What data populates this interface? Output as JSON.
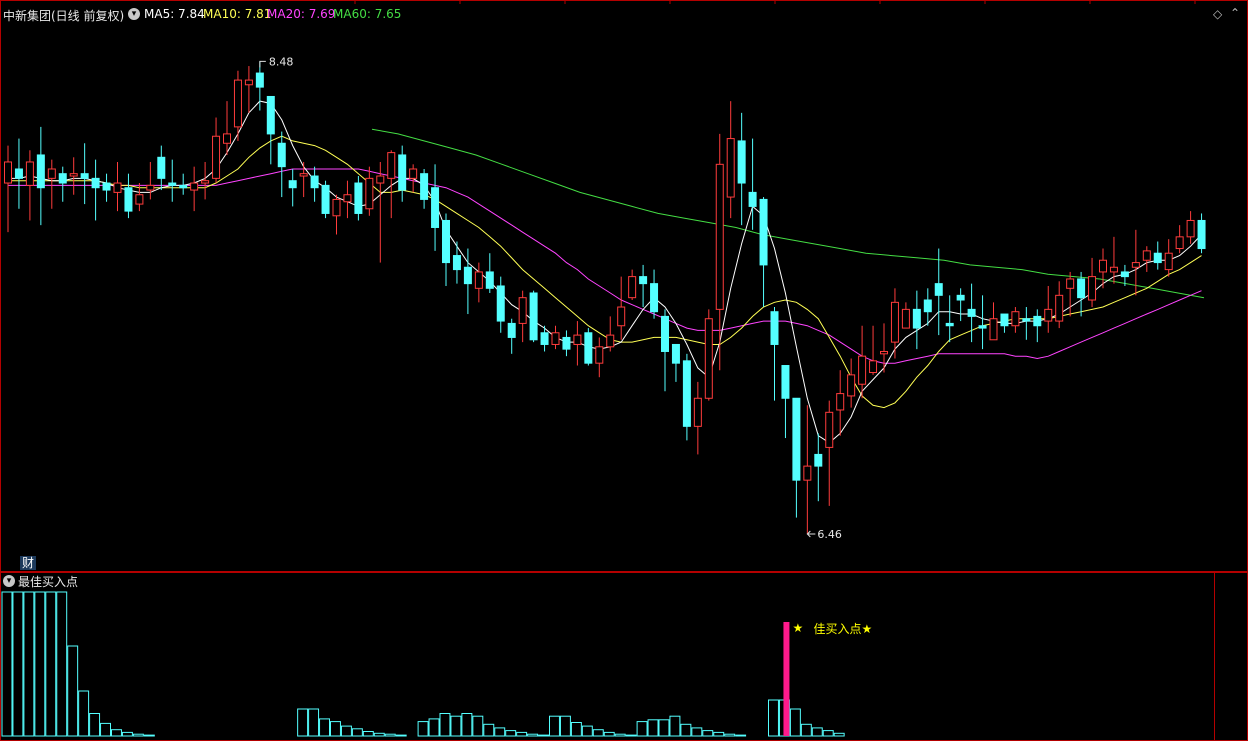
{
  "header": {
    "stock_name": "中新集团(日线 前复权)",
    "ma_labels": [
      {
        "text": "MA5: 7.84",
        "color": "#ffffff"
      },
      {
        "text": "MA10: 7.81",
        "color": "#ffff55"
      },
      {
        "text": "MA20: 7.69",
        "color": "#ff44ff"
      },
      {
        "text": "MA60: 7.65",
        "color": "#44dd44"
      }
    ]
  },
  "price_panel": {
    "high_label": "8.48",
    "low_label": "6.46",
    "fin_badge": "财"
  },
  "indicator_panel": {
    "title": "最佳买入点",
    "signal_text": "佳买入点★",
    "signal_star": "★"
  },
  "colors": {
    "up": "#ff3c3c",
    "down": "#54ffff",
    "frame": "#b40000",
    "ma5": "#ffffff",
    "ma10": "#ffff55",
    "ma20": "#ff44ff",
    "ma60": "#44dd44",
    "signal_bar": "#ff1a8c",
    "signal_text": "#ffff00"
  },
  "chart_data": {
    "type": "candlestick",
    "ylim": [
      6.4,
      8.55
    ],
    "candles": [
      [
        7.96,
        8.05,
        7.75,
        8.12
      ],
      [
        8.02,
        7.98,
        7.85,
        8.15
      ],
      [
        7.95,
        8.05,
        7.8,
        8.1
      ],
      [
        8.08,
        7.94,
        7.78,
        8.2
      ],
      [
        7.98,
        8.02,
        7.85,
        8.06
      ],
      [
        8.0,
        7.96,
        7.88,
        8.03
      ],
      [
        7.99,
        8.0,
        7.91,
        8.07
      ],
      [
        8.0,
        7.98,
        7.87,
        8.13
      ],
      [
        7.98,
        7.94,
        7.8,
        8.06
      ],
      [
        7.96,
        7.93,
        7.88,
        8.0
      ],
      [
        7.92,
        7.96,
        7.84,
        8.05
      ],
      [
        7.94,
        7.84,
        7.81,
        8.0
      ],
      [
        7.87,
        7.91,
        7.84,
        7.96
      ],
      [
        7.93,
        7.95,
        7.89,
        8.05
      ],
      [
        8.07,
        7.98,
        7.93,
        8.12
      ],
      [
        7.96,
        7.95,
        7.88,
        8.06
      ],
      [
        7.95,
        7.94,
        7.91,
        8.0
      ],
      [
        7.93,
        7.96,
        7.84,
        8.03
      ],
      [
        7.96,
        7.97,
        7.89,
        8.05
      ],
      [
        7.98,
        8.16,
        7.96,
        8.24
      ],
      [
        8.13,
        8.17,
        8.08,
        8.31
      ],
      [
        8.2,
        8.4,
        8.14,
        8.44
      ],
      [
        8.38,
        8.4,
        8.26,
        8.46
      ],
      [
        8.43,
        8.37,
        8.27,
        8.48
      ],
      [
        8.33,
        8.17,
        8.04,
        8.33
      ],
      [
        8.13,
        8.03,
        7.9,
        8.18
      ],
      [
        7.97,
        7.94,
        7.86,
        8.02
      ],
      [
        7.99,
        8.0,
        7.9,
        8.05
      ],
      [
        7.99,
        7.94,
        7.88,
        8.03
      ],
      [
        7.95,
        7.83,
        7.81,
        7.97
      ],
      [
        7.82,
        7.89,
        7.74,
        7.91
      ],
      [
        7.88,
        7.91,
        7.81,
        7.97
      ],
      [
        7.96,
        7.83,
        7.8,
        7.99
      ],
      [
        7.85,
        7.98,
        7.82,
        8.03
      ],
      [
        7.96,
        7.99,
        7.62,
        8.05
      ],
      [
        7.98,
        8.09,
        7.81,
        8.1
      ],
      [
        8.08,
        7.93,
        7.88,
        8.12
      ],
      [
        7.98,
        8.02,
        7.92,
        8.04
      ],
      [
        8.0,
        7.89,
        7.85,
        8.02
      ],
      [
        7.94,
        7.77,
        7.67,
        8.04
      ],
      [
        7.8,
        7.62,
        7.52,
        7.83
      ],
      [
        7.65,
        7.59,
        7.53,
        7.71
      ],
      [
        7.6,
        7.53,
        7.4,
        7.68
      ],
      [
        7.51,
        7.58,
        7.45,
        7.62
      ],
      [
        7.58,
        7.51,
        7.49,
        7.66
      ],
      [
        7.52,
        7.37,
        7.32,
        7.56
      ],
      [
        7.36,
        7.3,
        7.23,
        7.38
      ],
      [
        7.36,
        7.47,
        7.28,
        7.5
      ],
      [
        7.49,
        7.29,
        7.28,
        7.5
      ],
      [
        7.32,
        7.27,
        7.24,
        7.35
      ],
      [
        7.27,
        7.32,
        7.25,
        7.35
      ],
      [
        7.3,
        7.25,
        7.22,
        7.33
      ],
      [
        7.27,
        7.31,
        7.18,
        7.37
      ],
      [
        7.32,
        7.19,
        7.18,
        7.34
      ],
      [
        7.19,
        7.26,
        7.13,
        7.3
      ],
      [
        7.26,
        7.31,
        7.24,
        7.39
      ],
      [
        7.35,
        7.43,
        7.29,
        7.56
      ],
      [
        7.47,
        7.56,
        7.46,
        7.59
      ],
      [
        7.56,
        7.53,
        7.43,
        7.61
      ],
      [
        7.53,
        7.41,
        7.38,
        7.59
      ],
      [
        7.39,
        7.24,
        7.07,
        7.42
      ],
      [
        7.27,
        7.19,
        7.11,
        7.27
      ],
      [
        7.2,
        6.92,
        6.86,
        7.23
      ],
      [
        6.92,
        7.04,
        6.8,
        7.11
      ],
      [
        7.04,
        7.38,
        7.03,
        7.42
      ],
      [
        7.42,
        8.04,
        7.16,
        8.17
      ],
      [
        7.9,
        8.15,
        7.81,
        8.31
      ],
      [
        8.14,
        7.96,
        7.78,
        8.26
      ],
      [
        7.92,
        7.86,
        7.76,
        8.15
      ],
      [
        7.89,
        7.61,
        7.43,
        7.9
      ],
      [
        7.41,
        7.27,
        7.03,
        7.43
      ],
      [
        7.18,
        7.04,
        6.87,
        7.18
      ],
      [
        7.04,
        6.69,
        6.53,
        7.04
      ],
      [
        6.69,
        6.75,
        6.46,
        7.01
      ],
      [
        6.8,
        6.75,
        6.6,
        6.89
      ],
      [
        6.83,
        6.98,
        6.58,
        7.03
      ],
      [
        6.99,
        7.06,
        6.88,
        7.16
      ],
      [
        7.05,
        7.14,
        7.0,
        7.21
      ],
      [
        7.1,
        7.22,
        7.04,
        7.35
      ],
      [
        7.15,
        7.2,
        7.14,
        7.35
      ],
      [
        7.23,
        7.24,
        7.15,
        7.36
      ],
      [
        7.28,
        7.45,
        7.21,
        7.51
      ],
      [
        7.34,
        7.42,
        7.36,
        7.45
      ],
      [
        7.42,
        7.34,
        7.25,
        7.5
      ],
      [
        7.46,
        7.41,
        7.35,
        7.51
      ],
      [
        7.53,
        7.48,
        7.31,
        7.68
      ],
      [
        7.36,
        7.35,
        7.28,
        7.48
      ],
      [
        7.48,
        7.46,
        7.37,
        7.51
      ],
      [
        7.42,
        7.39,
        7.28,
        7.53
      ],
      [
        7.35,
        7.34,
        7.25,
        7.48
      ],
      [
        7.29,
        7.38,
        7.33,
        7.45
      ],
      [
        7.4,
        7.35,
        7.32,
        7.39
      ],
      [
        7.35,
        7.41,
        7.32,
        7.43
      ],
      [
        7.38,
        7.37,
        7.29,
        7.43
      ],
      [
        7.39,
        7.35,
        7.28,
        7.42
      ],
      [
        7.37,
        7.42,
        7.32,
        7.52
      ],
      [
        7.37,
        7.48,
        7.34,
        7.54
      ],
      [
        7.51,
        7.55,
        7.39,
        7.58
      ],
      [
        7.55,
        7.47,
        7.39,
        7.58
      ],
      [
        7.46,
        7.56,
        7.43,
        7.64
      ],
      [
        7.58,
        7.63,
        7.51,
        7.68
      ],
      [
        7.58,
        7.6,
        7.53,
        7.73
      ],
      [
        7.58,
        7.56,
        7.52,
        7.61
      ],
      [
        7.6,
        7.62,
        7.48,
        7.76
      ],
      [
        7.63,
        7.67,
        7.58,
        7.69
      ],
      [
        7.66,
        7.62,
        7.59,
        7.71
      ],
      [
        7.59,
        7.66,
        7.56,
        7.72
      ],
      [
        7.68,
        7.73,
        7.66,
        7.78
      ],
      [
        7.73,
        7.8,
        7.7,
        7.84
      ],
      [
        7.8,
        7.68,
        7.66,
        7.83
      ]
    ],
    "ma5": [
      7.98,
      7.98,
      7.99,
      7.98,
      7.97,
      7.97,
      7.98,
      7.98,
      7.97,
      7.96,
      7.94,
      7.93,
      7.92,
      7.92,
      7.94,
      7.95,
      7.95,
      7.96,
      7.98,
      8.02,
      8.09,
      8.17,
      8.26,
      8.31,
      8.3,
      8.23,
      8.12,
      8.03,
      7.97,
      7.94,
      7.9,
      7.88,
      7.86,
      7.87,
      7.91,
      7.95,
      7.98,
      7.98,
      7.95,
      7.88,
      7.76,
      7.69,
      7.62,
      7.58,
      7.54,
      7.49,
      7.44,
      7.41,
      7.37,
      7.34,
      7.3,
      7.28,
      7.28,
      7.26,
      7.25,
      7.26,
      7.28,
      7.35,
      7.42,
      7.47,
      7.43,
      7.36,
      7.27,
      7.17,
      7.13,
      7.28,
      7.51,
      7.7,
      7.86,
      7.82,
      7.68,
      7.49,
      7.26,
      7.04,
      6.88,
      6.85,
      6.89,
      6.96,
      7.07,
      7.12,
      7.17,
      7.25,
      7.3,
      7.33,
      7.36,
      7.41,
      7.41,
      7.4,
      7.4,
      7.38,
      7.37,
      7.36,
      7.36,
      7.37,
      7.37,
      7.38,
      7.4,
      7.43,
      7.46,
      7.49,
      7.53,
      7.56,
      7.57,
      7.59,
      7.62,
      7.63,
      7.63,
      7.65,
      7.69,
      7.74
    ],
    "ma10": [
      7.97,
      7.97,
      7.97,
      7.97,
      7.97,
      7.97,
      7.97,
      7.97,
      7.97,
      7.96,
      7.95,
      7.95,
      7.94,
      7.94,
      7.94,
      7.94,
      7.94,
      7.94,
      7.94,
      7.96,
      7.99,
      8.02,
      8.07,
      8.11,
      8.14,
      8.16,
      8.14,
      8.13,
      8.12,
      8.1,
      8.07,
      8.04,
      8.0,
      7.96,
      7.92,
      7.92,
      7.93,
      7.92,
      7.91,
      7.89,
      7.86,
      7.83,
      7.8,
      7.77,
      7.73,
      7.69,
      7.64,
      7.59,
      7.55,
      7.51,
      7.47,
      7.43,
      7.39,
      7.35,
      7.32,
      7.29,
      7.28,
      7.28,
      7.29,
      7.3,
      7.3,
      7.3,
      7.29,
      7.28,
      7.27,
      7.27,
      7.3,
      7.34,
      7.39,
      7.43,
      7.45,
      7.46,
      7.45,
      7.42,
      7.38,
      7.3,
      7.22,
      7.13,
      7.05,
      7.01,
      7.0,
      7.02,
      7.07,
      7.13,
      7.18,
      7.24,
      7.29,
      7.31,
      7.33,
      7.35,
      7.36,
      7.37,
      7.38,
      7.38,
      7.38,
      7.38,
      7.39,
      7.4,
      7.41,
      7.42,
      7.43,
      7.45,
      7.47,
      7.49,
      7.51,
      7.54,
      7.57,
      7.59,
      7.62,
      7.65
    ],
    "ma20": [
      7.95,
      7.95,
      7.95,
      7.95,
      7.95,
      7.95,
      7.95,
      7.95,
      7.95,
      7.95,
      7.95,
      7.95,
      7.95,
      7.95,
      7.95,
      7.95,
      7.95,
      7.95,
      7.95,
      7.95,
      7.96,
      7.97,
      7.98,
      7.99,
      8.0,
      8.01,
      8.02,
      8.02,
      8.02,
      8.02,
      8.02,
      8.02,
      8.02,
      8.01,
      8.0,
      7.99,
      7.98,
      7.97,
      7.96,
      7.95,
      7.94,
      7.92,
      7.9,
      7.87,
      7.84,
      7.81,
      7.78,
      7.75,
      7.72,
      7.69,
      7.66,
      7.62,
      7.59,
      7.55,
      7.52,
      7.49,
      7.46,
      7.44,
      7.42,
      7.4,
      7.38,
      7.36,
      7.34,
      7.33,
      7.33,
      7.33,
      7.34,
      7.35,
      7.36,
      7.37,
      7.37,
      7.37,
      7.36,
      7.35,
      7.33,
      7.31,
      7.28,
      7.25,
      7.22,
      7.2,
      7.19,
      7.19,
      7.2,
      7.21,
      7.22,
      7.23,
      7.23,
      7.23,
      7.23,
      7.23,
      7.23,
      7.23,
      7.22,
      7.22,
      7.21,
      7.22,
      7.24,
      7.26,
      7.28,
      7.3,
      7.32,
      7.34,
      7.36,
      7.38,
      7.4,
      7.42,
      7.44,
      7.46,
      7.48,
      7.5
    ]
  },
  "ma60_line": [
    8.19,
    8.17,
    8.14,
    8.11,
    8.08,
    8.04,
    8.0,
    7.96,
    7.92,
    7.89,
    7.86,
    7.83,
    7.81,
    7.79,
    7.77,
    7.74,
    7.72,
    7.7,
    7.68,
    7.66,
    7.65,
    7.64,
    7.63,
    7.61,
    7.6,
    7.59,
    7.57,
    7.56,
    7.55,
    7.53,
    7.51,
    7.49,
    7.47
  ],
  "indicator_bars": [
    [
      0,
      160
    ],
    [
      1,
      160
    ],
    [
      2,
      160
    ],
    [
      3,
      160
    ],
    [
      4,
      160
    ],
    [
      5,
      160
    ],
    [
      6,
      100
    ],
    [
      7,
      50
    ],
    [
      8,
      25
    ],
    [
      9,
      14
    ],
    [
      10,
      7
    ],
    [
      11,
      4
    ],
    [
      12,
      2
    ],
    [
      13,
      1
    ],
    [
      27,
      30
    ],
    [
      28,
      30
    ],
    [
      29,
      19
    ],
    [
      30,
      16
    ],
    [
      31,
      11
    ],
    [
      32,
      8
    ],
    [
      33,
      5
    ],
    [
      34,
      3
    ],
    [
      35,
      2
    ],
    [
      36,
      1
    ],
    [
      38,
      16
    ],
    [
      39,
      19
    ],
    [
      40,
      25
    ],
    [
      41,
      22
    ],
    [
      42,
      25
    ],
    [
      43,
      22
    ],
    [
      44,
      13
    ],
    [
      45,
      9
    ],
    [
      46,
      6
    ],
    [
      47,
      4
    ],
    [
      48,
      2
    ],
    [
      49,
      1
    ],
    [
      50,
      22
    ],
    [
      51,
      22
    ],
    [
      52,
      15
    ],
    [
      53,
      11
    ],
    [
      54,
      7
    ],
    [
      55,
      4
    ],
    [
      56,
      2
    ],
    [
      57,
      1
    ],
    [
      58,
      16
    ],
    [
      59,
      18
    ],
    [
      60,
      18
    ],
    [
      61,
      22
    ],
    [
      62,
      13
    ],
    [
      63,
      9
    ],
    [
      64,
      6
    ],
    [
      65,
      4
    ],
    [
      66,
      2
    ],
    [
      67,
      1
    ],
    [
      70,
      40
    ],
    [
      71,
      40
    ],
    [
      72,
      30
    ],
    [
      73,
      13
    ],
    [
      74,
      9
    ],
    [
      75,
      6
    ],
    [
      76,
      3
    ]
  ],
  "signal_index": 71,
  "signal_value": 114
}
